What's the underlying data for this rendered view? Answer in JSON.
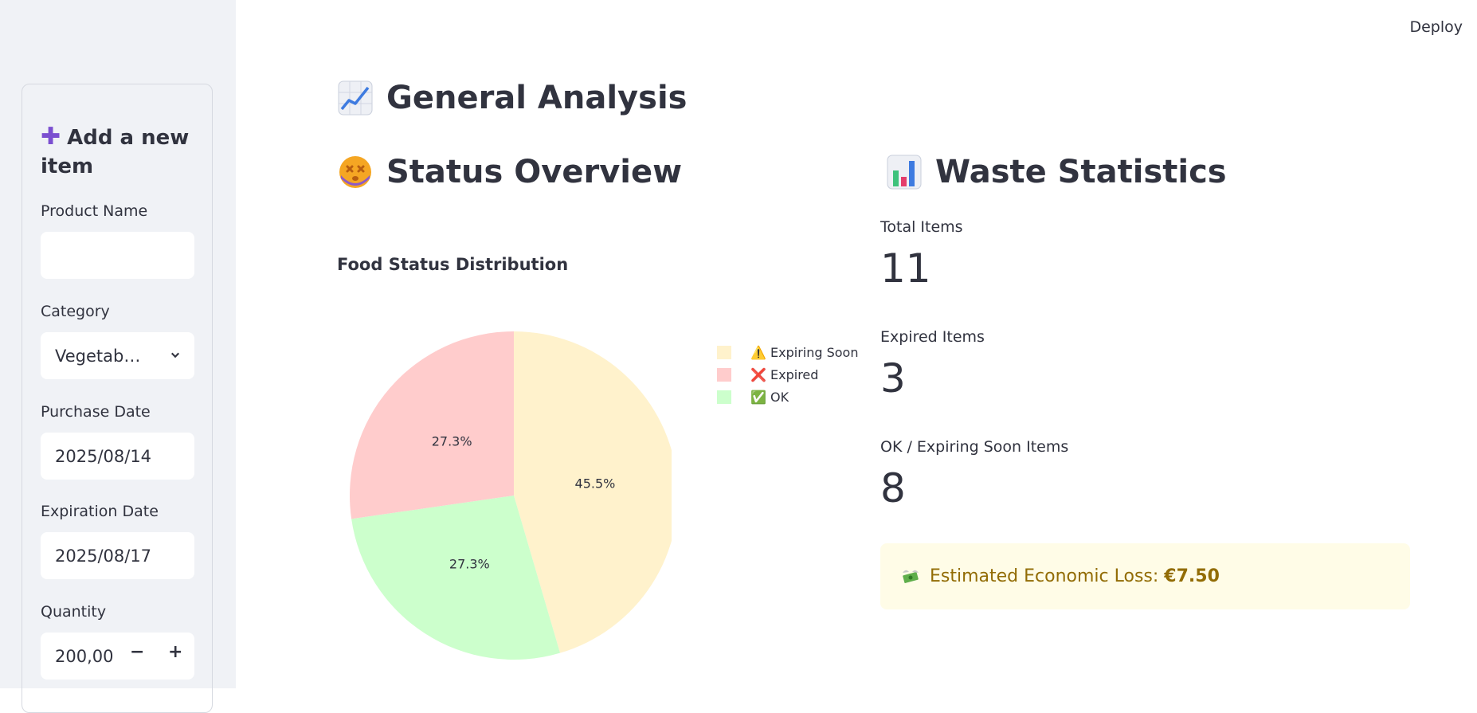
{
  "header": {
    "deploy_label": "Deploy"
  },
  "sidebar": {
    "form_title": "Add a new item",
    "form_title_icon": "heavy-plus-icon",
    "fields": {
      "product_name": {
        "label": "Product Name",
        "value": ""
      },
      "category": {
        "label": "Category",
        "value": "Vegetab…"
      },
      "purchase_date": {
        "label": "Purchase Date",
        "value": "2025/08/14"
      },
      "expiration_date": {
        "label": "Expiration Date",
        "value": "2025/08/17"
      },
      "quantity": {
        "label": "Quantity",
        "value": "200,00",
        "minus": "−",
        "plus": "+"
      }
    }
  },
  "main": {
    "title": "General Analysis",
    "title_icon": "chart-increasing-icon",
    "status": {
      "heading": "Status Overview",
      "heading_icon": "dizzy-face-icon",
      "chart_title": "Food Status Distribution"
    },
    "waste": {
      "heading": "Waste Statistics",
      "heading_icon": "bar-chart-icon",
      "metrics": [
        {
          "label": "Total Items",
          "value": "11"
        },
        {
          "label": "Expired Items",
          "value": "3"
        },
        {
          "label": "OK / Expiring Soon Items",
          "value": "8"
        }
      ],
      "alert": {
        "prefix": "Estimated Economic Loss: ",
        "amount": "€7.50",
        "icon": "money-with-wings-icon"
      }
    }
  },
  "chart_data": {
    "type": "pie",
    "title": "Food Status Distribution",
    "categories": [
      "⚠️ Expiring Soon",
      "❌ Expired",
      "✅ OK"
    ],
    "values": [
      45.5,
      27.3,
      27.3
    ],
    "labels": [
      "45.5%",
      "27.3%",
      "27.3%"
    ],
    "colors": [
      "#fff2cc",
      "#ffcccc",
      "#ccffcc"
    ],
    "legend_position": "right"
  }
}
